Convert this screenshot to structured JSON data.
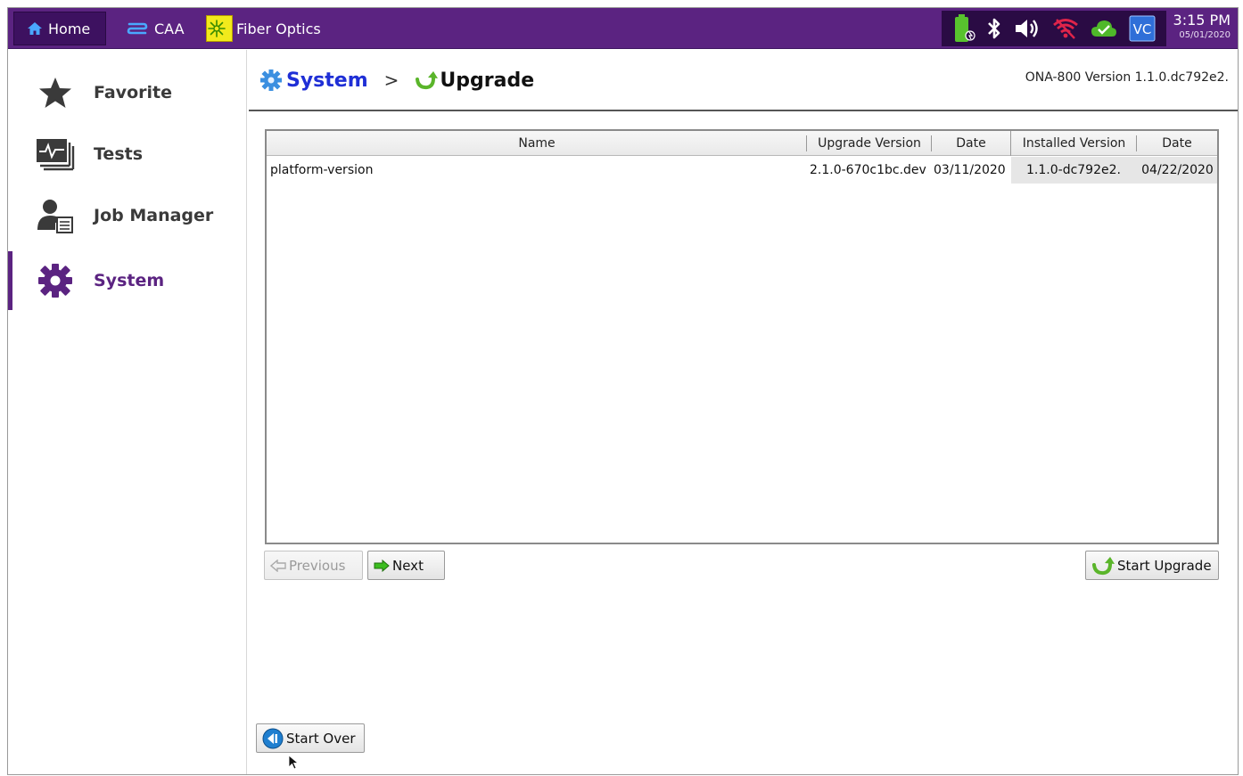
{
  "topbar": {
    "home_label": "Home",
    "caa_label": "CAA",
    "fiber_label": "Fiber Optics",
    "status_icons": [
      "battery-charging-icon",
      "bluetooth-icon",
      "speaker-icon",
      "wifi-off-icon",
      "cloud-check-icon",
      "vc-icon"
    ],
    "clock_time": "3:15 PM",
    "clock_date": "05/01/2020"
  },
  "sidebar": {
    "items": [
      {
        "label": "Favorite",
        "icon": "star-icon"
      },
      {
        "label": "Tests",
        "icon": "tests-icon"
      },
      {
        "label": "Job Manager",
        "icon": "job-manager-icon"
      },
      {
        "label": "System",
        "icon": "gear-icon",
        "active": true
      }
    ]
  },
  "header": {
    "crumb_system": "System",
    "crumb_separator": ">",
    "crumb_upgrade": "Upgrade",
    "version": "ONA-800 Version 1.1.0.dc792e2."
  },
  "table": {
    "columns": [
      "Name",
      "Upgrade Version",
      "Date",
      "Installed Version",
      "Date"
    ],
    "rows": [
      [
        "platform-version",
        "2.1.0-670c1bc.dev",
        "03/11/2020",
        "1.1.0-dc792e2.",
        "04/22/2020"
      ]
    ]
  },
  "buttons": {
    "previous": "Previous",
    "next": "Next",
    "start_upgrade": "Start Upgrade",
    "start_over": "Start Over"
  },
  "colors": {
    "brand_purple": "#5b2381",
    "link_blue": "#1f2fd6",
    "upgrade_green": "#5ab52a"
  }
}
